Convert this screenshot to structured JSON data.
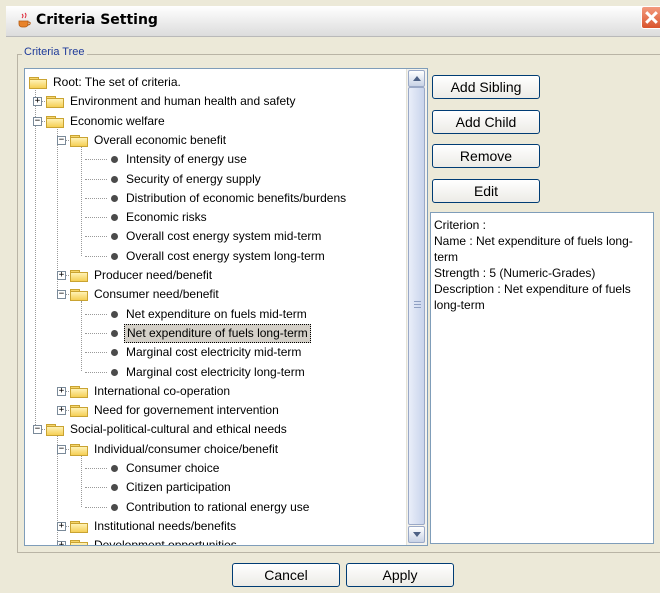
{
  "window": {
    "title": "Criteria Setting"
  },
  "group_label": "Criteria Tree",
  "tree": [
    {
      "label": "Root: The set of criteria.",
      "level": 0,
      "kind": "folder",
      "expander": ""
    },
    {
      "label": "Environment and human health and safety",
      "level": 1,
      "kind": "folder",
      "expander": "+"
    },
    {
      "label": "Economic welfare",
      "level": 1,
      "kind": "folder",
      "expander": "-"
    },
    {
      "label": "Overall economic benefit",
      "level": 2,
      "kind": "folder",
      "expander": "-"
    },
    {
      "label": "Intensity of energy use",
      "level": 3,
      "kind": "leaf",
      "expander": ""
    },
    {
      "label": "Security of energy supply",
      "level": 3,
      "kind": "leaf",
      "expander": ""
    },
    {
      "label": "Distribution of economic benefits/burdens",
      "level": 3,
      "kind": "leaf",
      "expander": ""
    },
    {
      "label": "Economic risks",
      "level": 3,
      "kind": "leaf",
      "expander": ""
    },
    {
      "label": "Overall cost energy system mid-term",
      "level": 3,
      "kind": "leaf",
      "expander": ""
    },
    {
      "label": "Overall cost energy system long-term",
      "level": 3,
      "kind": "leaf",
      "expander": ""
    },
    {
      "label": "Producer need/benefit",
      "level": 2,
      "kind": "folder",
      "expander": "+"
    },
    {
      "label": "Consumer need/benefit",
      "level": 2,
      "kind": "folder",
      "expander": "-"
    },
    {
      "label": "Net expenditure on fuels mid-term",
      "level": 3,
      "kind": "leaf",
      "expander": ""
    },
    {
      "label": "Net expenditure of fuels long-term",
      "level": 3,
      "kind": "leaf",
      "expander": "",
      "selected": true
    },
    {
      "label": "Marginal cost electricity mid-term",
      "level": 3,
      "kind": "leaf",
      "expander": ""
    },
    {
      "label": "Marginal cost electricity long-term",
      "level": 3,
      "kind": "leaf",
      "expander": ""
    },
    {
      "label": "International co-operation",
      "level": 2,
      "kind": "folder",
      "expander": "+"
    },
    {
      "label": "Need for governement intervention",
      "level": 2,
      "kind": "folder",
      "expander": "+"
    },
    {
      "label": "Social-political-cultural and ethical needs",
      "level": 1,
      "kind": "folder",
      "expander": "-"
    },
    {
      "label": "Individual/consumer choice/benefit",
      "level": 2,
      "kind": "folder",
      "expander": "-"
    },
    {
      "label": "Consumer choice",
      "level": 3,
      "kind": "leaf",
      "expander": ""
    },
    {
      "label": "Citizen participation",
      "level": 3,
      "kind": "leaf",
      "expander": ""
    },
    {
      "label": "Contribution to rational energy use",
      "level": 3,
      "kind": "leaf",
      "expander": ""
    },
    {
      "label": "Institutional needs/benefits",
      "level": 2,
      "kind": "folder",
      "expander": "+"
    },
    {
      "label": "Development opportunities",
      "level": 2,
      "kind": "folder",
      "expander": "+"
    }
  ],
  "buttons": {
    "add_sibling": "Add Sibling",
    "add_child": "Add Child",
    "remove": "Remove",
    "edit": "Edit",
    "cancel": "Cancel",
    "apply": "Apply"
  },
  "details": {
    "criterion": "Criterion :",
    "name": "Name : Net expenditure of fuels long-term",
    "strength": "Strength : 5 (Numeric-Grades)",
    "description": "Description : Net expenditure of fuels long-term"
  },
  "colors": {
    "group_label": "#1f3b9a",
    "button_border": "#003c74",
    "close_button": "#d9532c"
  },
  "icons": {
    "app": "java-cup-icon",
    "close": "close-icon",
    "folder": "folder-icon",
    "leaf": "bullet-icon"
  }
}
